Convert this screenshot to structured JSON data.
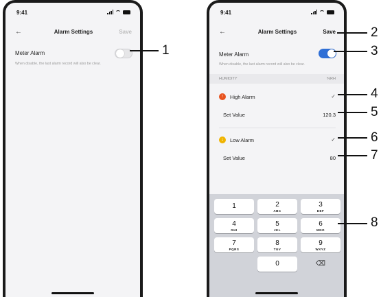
{
  "status": {
    "time": "9:41"
  },
  "screen_off": {
    "back_icon": "←",
    "title": "Alarm Settings",
    "save_label": "Save",
    "meter_alarm_label": "Meter Alarm",
    "meter_alarm_on": false,
    "hint": "When disable, the last alarm record will also be clear."
  },
  "screen_on": {
    "back_icon": "←",
    "title": "Alarm Settings",
    "save_label": "Save",
    "meter_alarm_label": "Meter Alarm",
    "meter_alarm_on": true,
    "hint": "When disable, the last alarm record will also be clear.",
    "section": {
      "name": "HUMIDITY",
      "unit": "%RH"
    },
    "high_alarm": {
      "icon": "↑",
      "label": "High Alarm",
      "check": "✓",
      "set_value_label": "Set Value",
      "value": "120.3"
    },
    "low_alarm": {
      "icon": "↓",
      "label": "Low Alarm",
      "check": "✓",
      "set_value_label": "Set Value",
      "value": "80"
    },
    "keypad": [
      {
        "digit": "1",
        "letters": ""
      },
      {
        "digit": "2",
        "letters": "ABC"
      },
      {
        "digit": "3",
        "letters": "DEF"
      },
      {
        "digit": "4",
        "letters": "GHI"
      },
      {
        "digit": "5",
        "letters": "JKL"
      },
      {
        "digit": "6",
        "letters": "MNO"
      },
      {
        "digit": "7",
        "letters": "PQRS"
      },
      {
        "digit": "8",
        "letters": "TUV"
      },
      {
        "digit": "9",
        "letters": "WXYZ"
      },
      {
        "digit": "0",
        "letters": ""
      }
    ],
    "delete_icon": "⌫"
  },
  "callouts": [
    "1",
    "2",
    "3",
    "4",
    "5",
    "6",
    "7",
    "8"
  ],
  "colors": {
    "toggle_on": "#2f6fd6",
    "high_icon": "#e8531f",
    "low_icon": "#f0b400"
  }
}
